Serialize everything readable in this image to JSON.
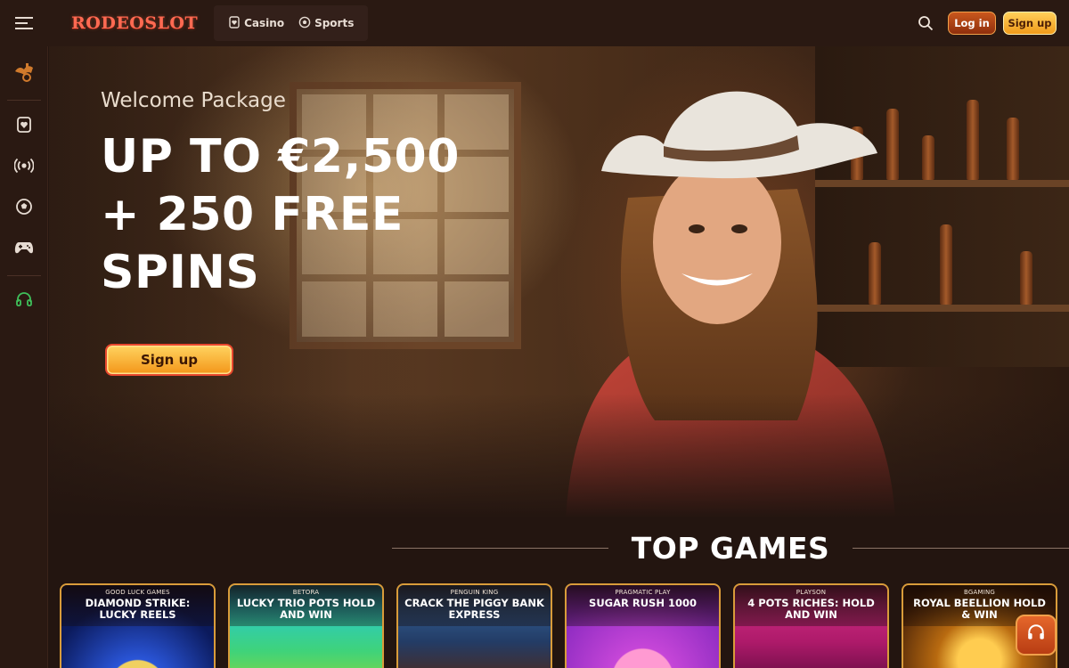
{
  "header": {
    "logo": "RODEOSLOT",
    "nav": [
      {
        "label": "Casino",
        "icon": "card-heart-icon"
      },
      {
        "label": "Sports",
        "icon": "soccer-ball-icon"
      }
    ],
    "login_label": "Log in",
    "signup_label": "Sign up"
  },
  "sidebar": {
    "items": [
      {
        "icon": "saddle-icon"
      },
      {
        "icon": "card-heart-icon"
      },
      {
        "icon": "live-broadcast-icon"
      },
      {
        "icon": "soccer-ball-icon"
      },
      {
        "icon": "gamepad-icon"
      },
      {
        "icon": "headset-icon"
      }
    ]
  },
  "hero": {
    "subtitle": "Welcome Package",
    "title": "UP TO €2,500 + 250 FREE SPINS",
    "cta_label": "Sign up"
  },
  "top_games": {
    "title": "TOP GAMES",
    "games": [
      {
        "provider": "GOOD LUCK GAMES",
        "name": "DIAMOND STRIKE: LUCKY REELS"
      },
      {
        "provider": "BETORA",
        "name": "LUCKY TRIO POTS HOLD AND WIN"
      },
      {
        "provider": "PENGUIN KING",
        "name": "CRACK THE PIGGY BANK EXPRESS"
      },
      {
        "provider": "PRAGMATIC PLAY",
        "name": "SUGAR RUSH 1000"
      },
      {
        "provider": "PLAYSON",
        "name": "4 POTS RICHES: HOLD AND WIN"
      },
      {
        "provider": "BGAMING",
        "name": "ROYAL BEELLION HOLD & WIN"
      }
    ]
  },
  "colors": {
    "background": "#231510",
    "accent_orange": "#f39519",
    "logo_red": "#ff6a52"
  }
}
